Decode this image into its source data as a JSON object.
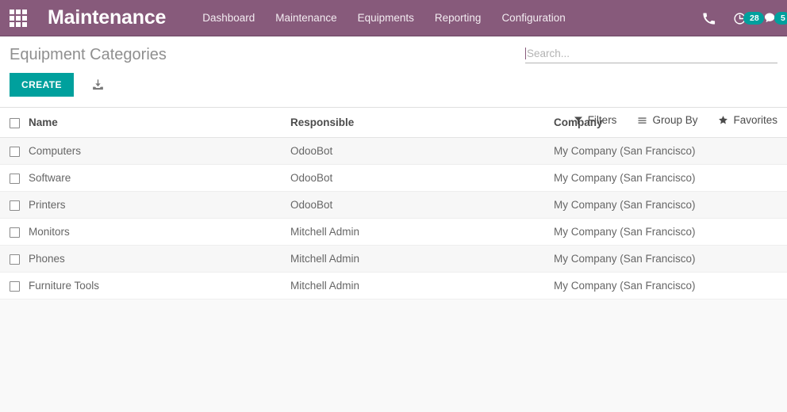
{
  "navbar": {
    "apps_icon": "apps-grid-icon",
    "brand": "Maintenance",
    "menu": [
      {
        "label": "Dashboard"
      },
      {
        "label": "Maintenance"
      },
      {
        "label": "Equipments"
      },
      {
        "label": "Reporting"
      },
      {
        "label": "Configuration"
      }
    ],
    "systray": {
      "phone_icon": "phone-icon",
      "activity_icon": "activity-clock-icon",
      "activity_count": "28",
      "messages_icon": "chat-bubble-icon",
      "messages_count": "5"
    },
    "colors": {
      "background": "#875a7b",
      "badge": "#00a09d"
    }
  },
  "control_panel": {
    "title": "Equipment Categories",
    "create_label": "CREATE",
    "import_icon": "import-upload-icon",
    "create_color": "#00a09d"
  },
  "search": {
    "placeholder": "Search...",
    "value": ""
  },
  "filter_bar": [
    {
      "label": "Filters",
      "icon": "funnel-icon"
    },
    {
      "label": "Group By",
      "icon": "hamburger-lines-icon"
    },
    {
      "label": "Favorites",
      "icon": "star-icon"
    }
  ],
  "table": {
    "columns": [
      "Name",
      "Responsible",
      "Company"
    ],
    "rows": [
      {
        "name": "Computers",
        "responsible": "OdooBot",
        "company": "My Company (San Francisco)"
      },
      {
        "name": "Software",
        "responsible": "OdooBot",
        "company": "My Company (San Francisco)"
      },
      {
        "name": "Printers",
        "responsible": "OdooBot",
        "company": "My Company (San Francisco)"
      },
      {
        "name": "Monitors",
        "responsible": "Mitchell Admin",
        "company": "My Company (San Francisco)"
      },
      {
        "name": "Phones",
        "responsible": "Mitchell Admin",
        "company": "My Company (San Francisco)"
      },
      {
        "name": "Furniture Tools",
        "responsible": "Mitchell Admin",
        "company": "My Company (San Francisco)"
      }
    ]
  }
}
